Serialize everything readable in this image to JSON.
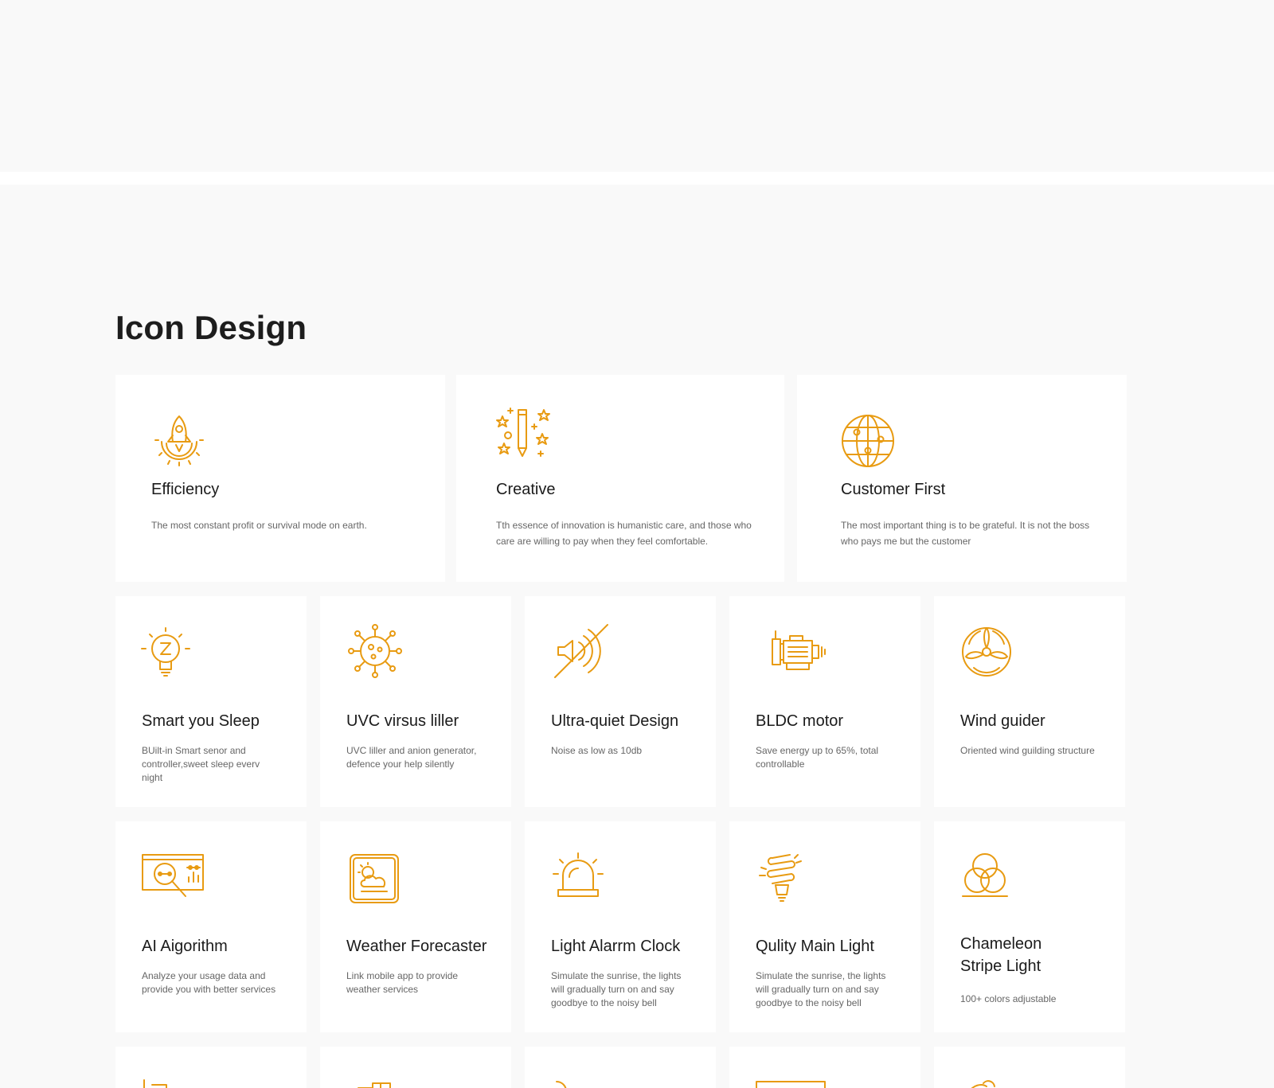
{
  "section": {
    "title": "Icon Design"
  },
  "accent_color": "#e89b12",
  "values": [
    {
      "icon": "rocket-gear-icon",
      "title": "Efficiency",
      "desc": "The most constant profit or survival mode on earth."
    },
    {
      "icon": "pencil-stars-icon",
      "title": "Creative",
      "desc": "Tth essence of innovation is humanistic care, and those who care are willing to pay when they feel comfortable."
    },
    {
      "icon": "globe-icon",
      "title": "Customer First",
      "desc": "The most important thing is to be grateful. It is not the boss who pays me but the customer"
    }
  ],
  "features_row1": [
    {
      "icon": "lightbulb-sleep-icon",
      "title": "Smart you Sleep",
      "desc": "BUilt-in Smart senor and controller,sweet sleep everv night"
    },
    {
      "icon": "virus-icon",
      "title": "UVC virsus liller",
      "desc": "UVC liller and anion generator, defence your help silently"
    },
    {
      "icon": "mute-speaker-icon",
      "title": "Ultra-quiet Design",
      "desc": "Noise as low as 10db"
    },
    {
      "icon": "motor-icon",
      "title": "BLDC motor",
      "desc": "Save energy up to 65%, total controllable"
    },
    {
      "icon": "fan-icon",
      "title": "Wind guider",
      "desc": "Oriented wind guilding structure"
    }
  ],
  "features_row2": [
    {
      "icon": "ai-analysis-icon",
      "title": "AI Aigorithm",
      "desc": "Analyze your usage data and provide you with better services"
    },
    {
      "icon": "weather-icon",
      "title": "Weather Forecaster",
      "desc": "Link mobile app to provide weather services"
    },
    {
      "icon": "alarm-light-icon",
      "title": "Light Alarrm Clock",
      "desc": "Simulate the sunrise, the lights will gradually turn on and say goodbye to the noisy bell"
    },
    {
      "icon": "spiral-bulb-icon",
      "title": "Qulity Main Light",
      "desc": "Simulate the sunrise, the lights will gradually turn on and say goodbye to the noisy bell"
    },
    {
      "icon": "color-circles-icon",
      "title": "Chameleon Stripe Light",
      "desc": "100+ colors adjustable"
    }
  ]
}
